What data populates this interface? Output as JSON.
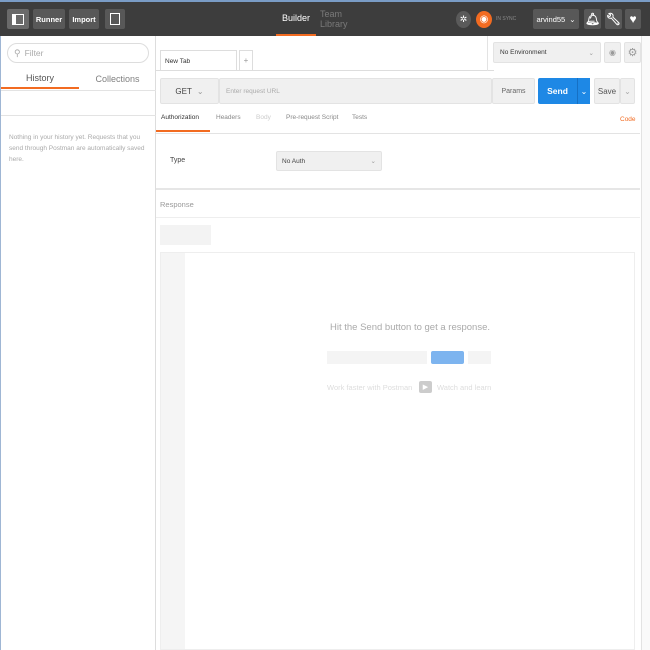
{
  "header": {
    "runner": "Runner",
    "import": "Import",
    "builder": "Builder",
    "team_library": "Team Library",
    "sync_status": "IN SYNC",
    "user": "arvind55",
    "accent": "#f26b21"
  },
  "sidebar": {
    "filter_placeholder": "Filter",
    "tabs": [
      "History",
      "Collections"
    ],
    "empty_message": "Nothing in your history yet. Requests that you send through Postman are automatically saved here."
  },
  "tabs": {
    "active": "New Tab",
    "add": "+"
  },
  "environment": {
    "selected": "No Environment"
  },
  "request": {
    "method": "GET",
    "url_placeholder": "Enter request URL",
    "params": "Params",
    "send": "Send",
    "save": "Save",
    "send_color": "#1e88e5"
  },
  "subtabs": [
    "Authorization",
    "Headers",
    "Body",
    "Pre-request Script",
    "Tests"
  ],
  "code": "Code",
  "auth": {
    "type_label": "Type",
    "type_value": "No Auth"
  },
  "response": {
    "title": "Response",
    "hint": "Hit the Send button to get a response.",
    "promo": "Work faster with Postman",
    "watch": "Watch and learn"
  }
}
